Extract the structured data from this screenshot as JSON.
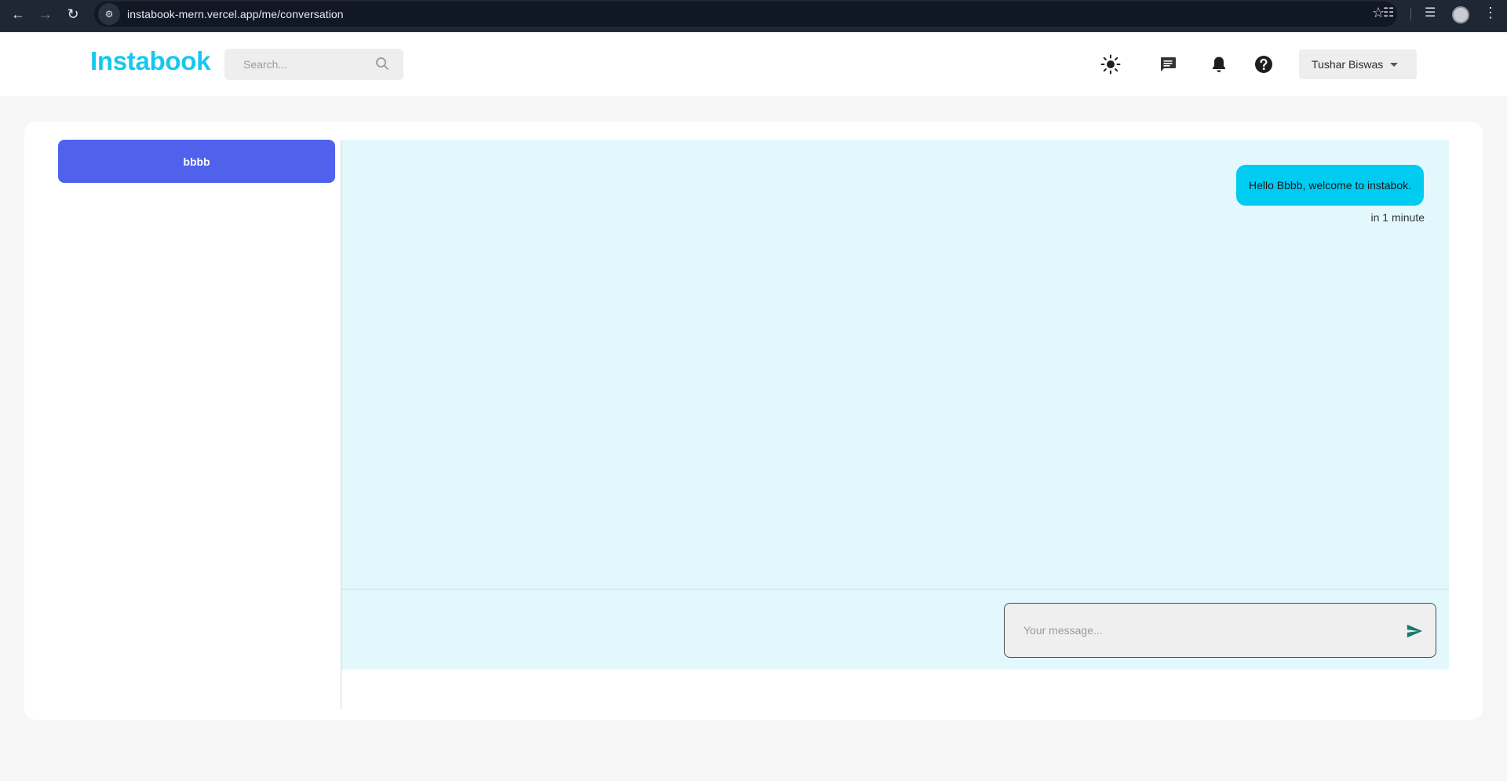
{
  "browser": {
    "url": "instabook-mern.vercel.app/me/conversation"
  },
  "header": {
    "logo": "Instabook",
    "search_placeholder": "Search...",
    "user_name": "Tushar Biswas"
  },
  "conversations": [
    {
      "name": "bbbb"
    }
  ],
  "chat": {
    "messages": [
      {
        "text": "Hello Bbbb, welcome to instabok.",
        "time": "in 1 minute"
      }
    ],
    "input_placeholder": "Your message..."
  },
  "colors": {
    "brand": "#14c8ef",
    "active_conversation": "#5062ec",
    "message_bubble": "#00ccf2",
    "chat_background": "#e3f8fd",
    "send_icon": "#1a7a6a"
  },
  "icons": {
    "theme_toggle": "sun-icon",
    "messages": "chat-icon",
    "notifications": "bell-icon",
    "help": "help-icon",
    "send": "send-icon"
  }
}
